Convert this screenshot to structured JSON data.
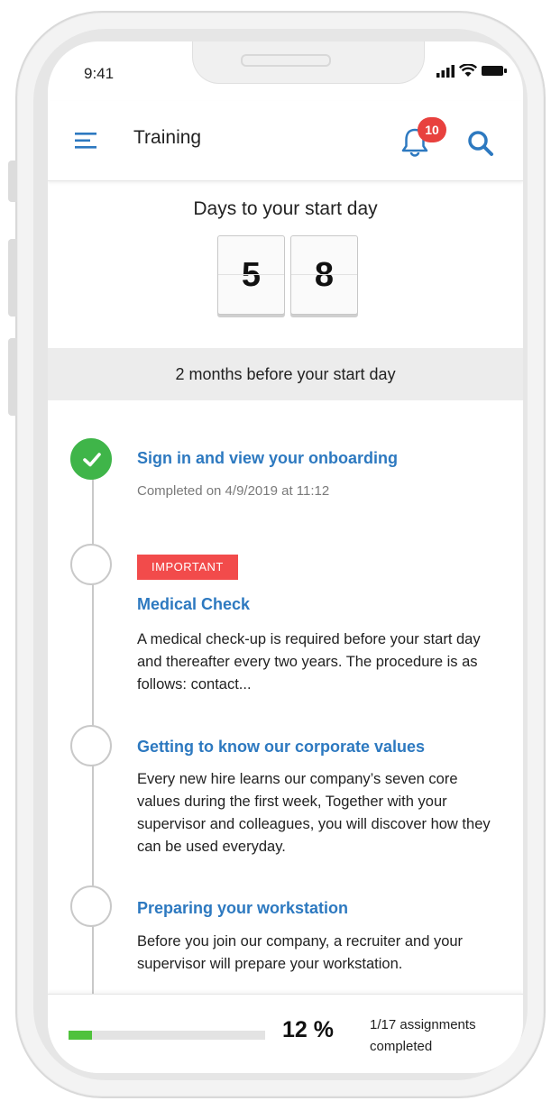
{
  "status_bar": {
    "time": "9:41"
  },
  "header": {
    "title": "Training",
    "notification_count": "10"
  },
  "countdown": {
    "title": "Days to your start day",
    "digits": [
      "5",
      "8"
    ]
  },
  "section": {
    "label": "2 months before your start day"
  },
  "timeline": [
    {
      "title": "Sign in and view your onboarding",
      "status": "completed",
      "meta": "Completed on 4/9/2019 at 11:12"
    },
    {
      "tag": "IMPORTANT",
      "title": "Medical Check",
      "description": "A medical check-up is required before your start day and thereafter every two years. The procedure is as follows: contact..."
    },
    {
      "title": "Getting to know our corporate values",
      "description": "Every new hire learns our company’s seven core values during the first week, Together with your supervisor and colleagues, you will discover how they can be used everyday."
    },
    {
      "title": "Preparing your workstation",
      "description": "Before you join our company, a recruiter and your supervisor will prepare your workstation."
    }
  ],
  "footer": {
    "progress_percent": 12,
    "percent_label": "12 %",
    "assignments_text": "1/17 assignments completed"
  },
  "colors": {
    "accent": "#2d79c0",
    "success": "#3fb549",
    "alert": "#e8413e",
    "progress": "#4fc23c"
  }
}
